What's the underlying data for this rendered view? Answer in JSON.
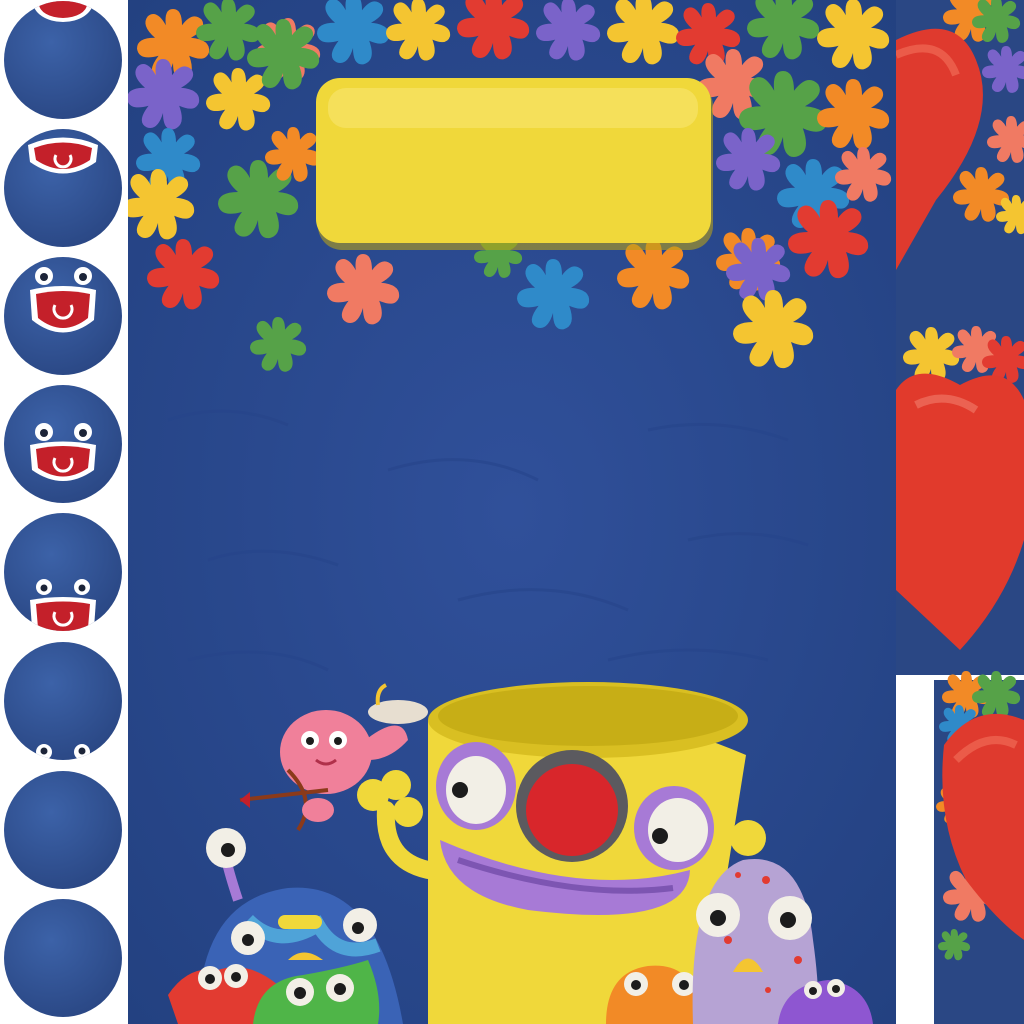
{
  "sheet": {
    "background": "#ffffff",
    "clay_blue": "#2f4f8f",
    "clay_yellow": "#f0d83a",
    "clay_red": "#e0392b",
    "clay_purple": "#a77ad6"
  },
  "animation_frames": [
    {
      "name": "frame-1",
      "mouth": "peek"
    },
    {
      "name": "frame-2",
      "mouth": "open"
    },
    {
      "name": "frame-3",
      "mouth": "open-eyes"
    },
    {
      "name": "frame-4",
      "mouth": "open-eyes-low"
    },
    {
      "name": "frame-5",
      "mouth": "sinking"
    },
    {
      "name": "frame-6",
      "mouth": "eyes-only"
    },
    {
      "name": "frame-7",
      "mouth": "empty"
    },
    {
      "name": "frame-8",
      "mouth": "empty"
    }
  ],
  "main_panel": {
    "title_plaque_text": "",
    "splat_colors": [
      "#e23b31",
      "#f4c531",
      "#f28a26",
      "#56a248",
      "#7a63c9",
      "#2f8ac9",
      "#f07a63"
    ]
  },
  "characters": [
    {
      "name": "yellow-cup-monster"
    },
    {
      "name": "pink-cupid-monster"
    },
    {
      "name": "blue-stalk-eye-monster"
    },
    {
      "name": "red-horned-monster"
    },
    {
      "name": "green-monster"
    },
    {
      "name": "orange-monster"
    },
    {
      "name": "spotted-purple-monster"
    },
    {
      "name": "small-purple-monster"
    }
  ],
  "heart_tiles": [
    {
      "name": "heart-tile-top"
    },
    {
      "name": "heart-tile-middle"
    },
    {
      "name": "heart-tile-bottom"
    }
  ]
}
